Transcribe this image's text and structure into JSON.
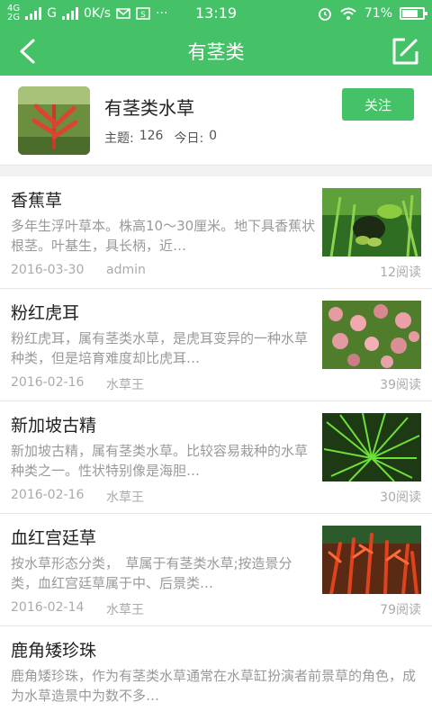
{
  "statusbar": {
    "net1": "4G",
    "net2": "2G",
    "carrier": "G",
    "speed": "0K/s",
    "time": "13:19",
    "battery": "71%",
    "dots": "···"
  },
  "header": {
    "title": "有茎类"
  },
  "board": {
    "name": "有茎类水草",
    "topics_label": "主题:",
    "topics": "126",
    "today_label": "今日:",
    "today": "0",
    "follow_label": "关注"
  },
  "colors": {
    "accent": "#45c267",
    "text_primary": "#222222",
    "text_secondary": "#999999"
  },
  "items": [
    {
      "title": "香蕉草",
      "summary": "多年生浮叶草本。株高10～30厘米。地下具香蕉状根茎。叶基生，具长柄，近…",
      "date": "2016-03-30",
      "author": "admin",
      "reads": "12阅读"
    },
    {
      "title": "粉红虎耳",
      "summary": "粉红虎耳，属有茎类水草，是虎耳变异的一种水草种类，但是培育难度却比虎耳…",
      "date": "2016-02-16",
      "author": "水草王",
      "reads": "39阅读"
    },
    {
      "title": "新加坡古精",
      "summary": "新加坡古精，属有茎类水草。比较容易栽种的水草种类之一。性状特别像是海胆…",
      "date": "2016-02-16",
      "author": "水草王",
      "reads": "30阅读"
    },
    {
      "title": "血红宫廷草",
      "summary": "按水草形态分类，　草属于有茎类水草;按造景分类，血红宫廷草属于中、后景类…",
      "date": "2016-02-14",
      "author": "水草王",
      "reads": "79阅读"
    },
    {
      "title": "鹿角矮珍珠",
      "summary": "鹿角矮珍珠，作为有茎类水草通常在水草缸扮演者前景草的角色，成为水草造景中为数不多…",
      "date": "",
      "author": "",
      "reads": ""
    }
  ]
}
